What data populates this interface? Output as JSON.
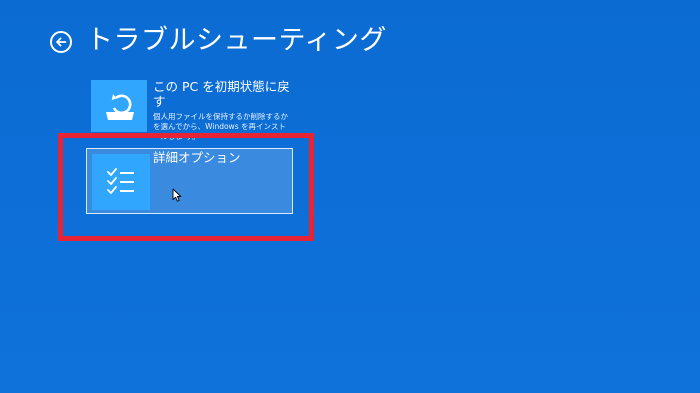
{
  "header": {
    "title": "トラブルシューティング",
    "back_icon": "back-arrow-circle-icon"
  },
  "options": {
    "reset": {
      "title": "この PC を初期状態に戻す",
      "description": "個人用ファイルを保持するか削除するかを選んでから、Windows を再インストールしま す。",
      "icon": "reset-pc-icon"
    },
    "advanced": {
      "title": "詳細オプション",
      "icon": "checklist-icon"
    }
  },
  "colors": {
    "background": "#0d6fd6",
    "tile_icon": "#31a6ff",
    "selected_tile": "#3a8bdf",
    "highlight": "#e82333"
  }
}
